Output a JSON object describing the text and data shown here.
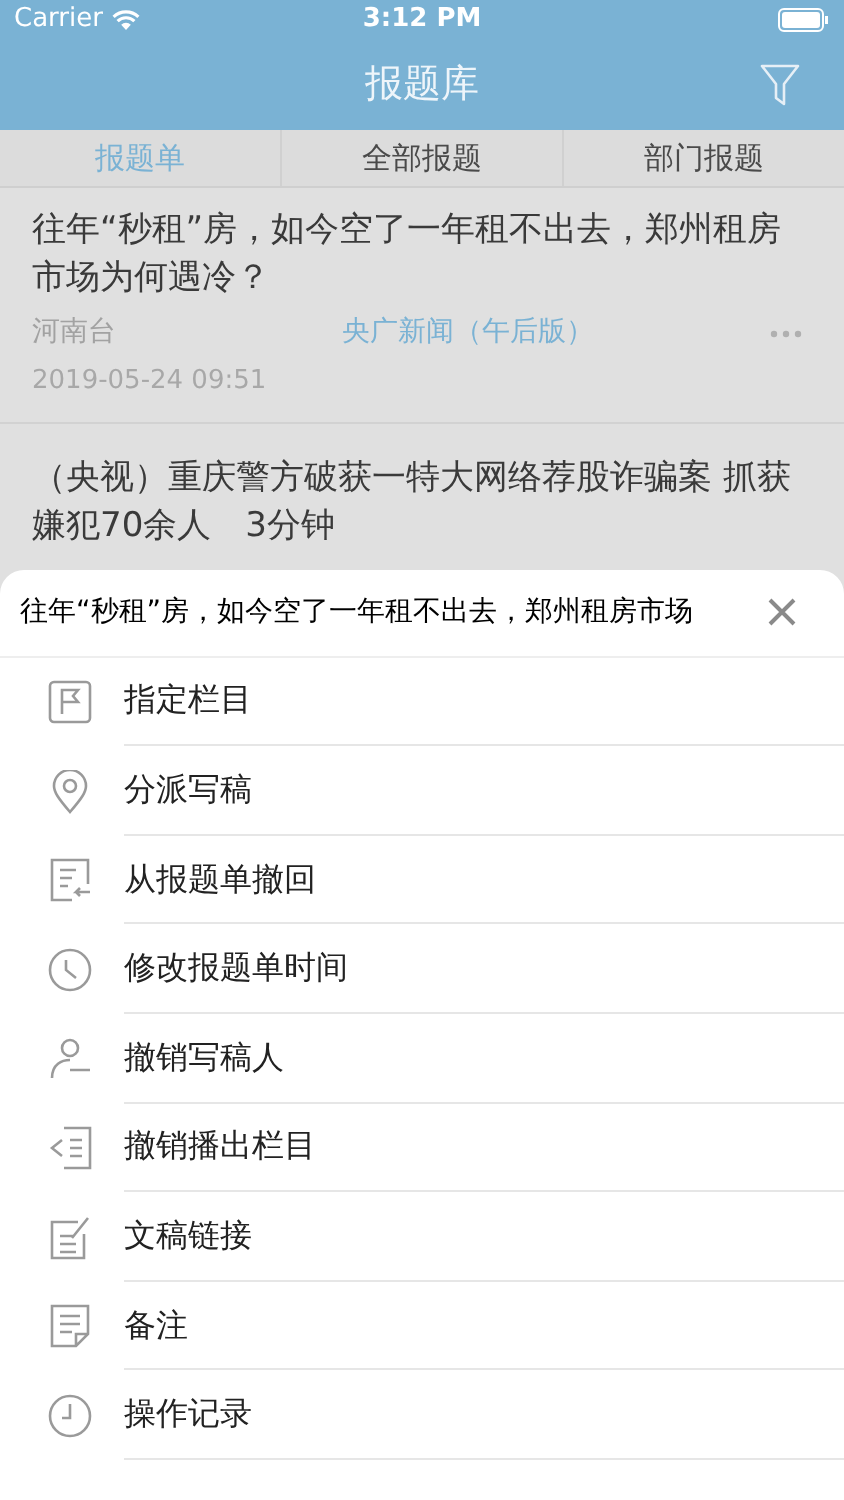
{
  "status_bar": {
    "carrier": "Carrier",
    "time": "3:12 PM"
  },
  "nav": {
    "title": "报题库"
  },
  "tabs": [
    {
      "label": "报题单",
      "selected": true
    },
    {
      "label": "全部报题",
      "selected": false
    },
    {
      "label": "部门报题",
      "selected": false
    }
  ],
  "items": [
    {
      "title": "往年“秒租”房，如今空了一年租不出去，郑州租房市场为何遇冷？",
      "source": "河南台",
      "program": "央广新闻（午后版）",
      "date": "2019-05-24 09:51"
    },
    {
      "title": "（央视）重庆警方破获一特大网络荐股诈骗案 抓获嫌犯70余人　3分钟"
    }
  ],
  "action_sheet": {
    "title": "往年“秒租”房，如今空了一年租不出去，郑州租房市场",
    "actions": [
      "指定栏目",
      "分派写稿",
      "从报题单撤回",
      "修改报题单时间",
      "撤销写稿人",
      "撤销播出栏目",
      "文稿链接",
      "备注",
      "操作记录"
    ]
  }
}
